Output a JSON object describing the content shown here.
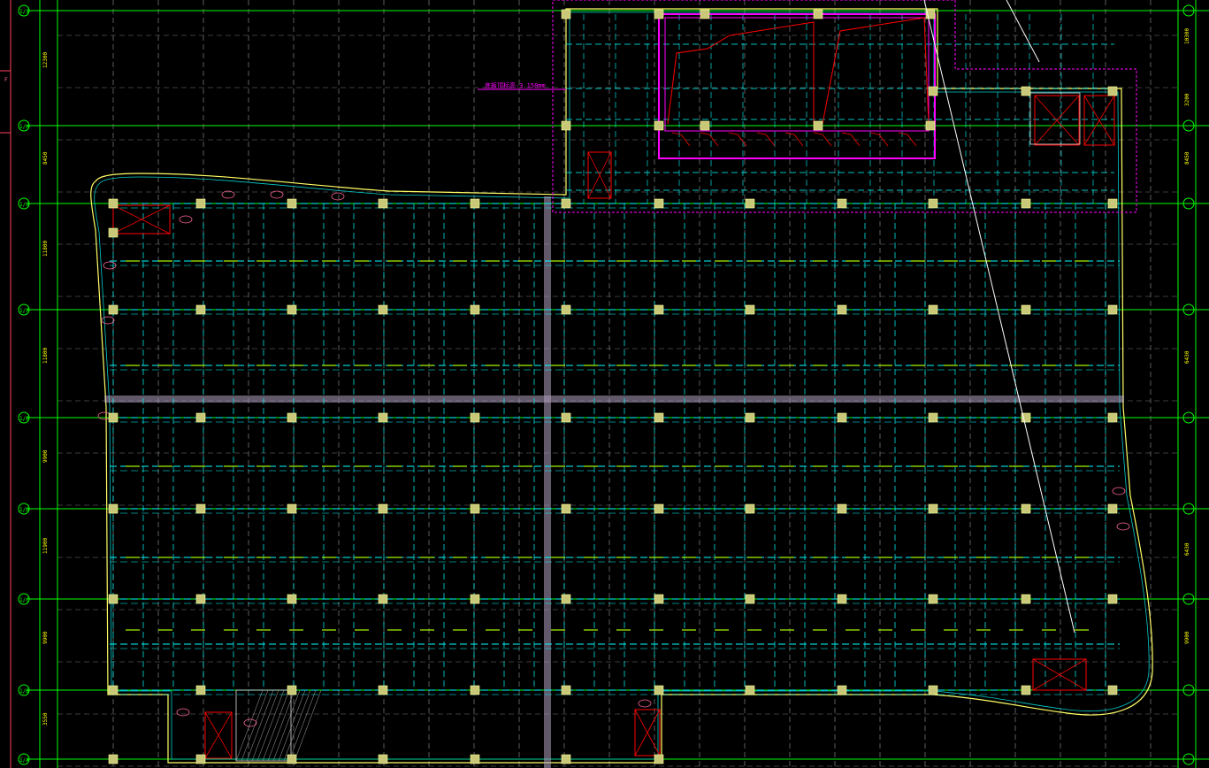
{
  "drawing": {
    "background": "#000000",
    "colors": {
      "axis": "#00ff00",
      "grid_dashed": "#ffffff",
      "beam": "#00ffff",
      "column_fill": "#c8c878",
      "column_stroke": "#ffff99",
      "wall": "#ff00ff",
      "rebar": "#ff0000",
      "outline": "#ffff66",
      "slab_band": "#b0a0c0",
      "dim_text": "#ffff00",
      "tag": "#ff6699"
    },
    "axis_labels_left": [
      "1/J",
      "1/H",
      "1/G",
      "1/F",
      "1/E",
      "1/D",
      "1/C",
      "1/B",
      "1/A"
    ],
    "dimensions_left": [
      "12300",
      "8450",
      "11800",
      "11800",
      "9900",
      "11900",
      "9900",
      "3550"
    ],
    "dimensions_right": [
      "10300",
      "3200",
      "8450",
      "6430",
      "6430",
      "9900"
    ],
    "annotation_note": "底板顶标高-3.150mm",
    "side_mark": "F",
    "icons": [
      "column-icon",
      "opening-cross-icon"
    ]
  }
}
